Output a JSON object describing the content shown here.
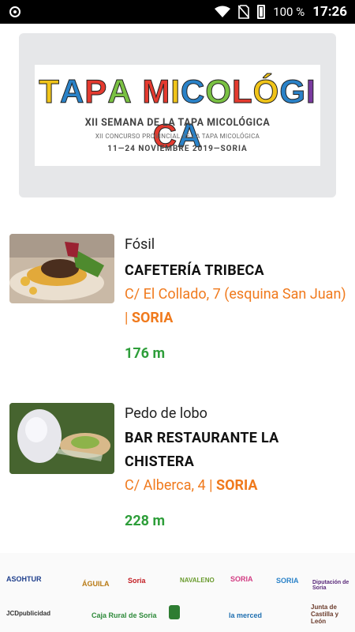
{
  "status_bar": {
    "battery_pct": "100 %",
    "time": "17:26"
  },
  "banner": {
    "title_letters": [
      "T",
      "A",
      "P",
      "A",
      " ",
      "M",
      "I",
      "C",
      "O",
      "L",
      "Ó",
      "G",
      "I",
      "C",
      "A"
    ],
    "title_colors": [
      "#f0c419",
      "#2a82c8",
      "#e43a2f",
      "#7ac143",
      "#ffffff",
      "#e43a2f",
      "#f0c419",
      "#2a82c8",
      "#7ac143",
      "#e43a2f",
      "#f0c419",
      "#2a82c8",
      "#7a3aa0",
      "#e43a2f",
      "#2a82c8"
    ],
    "subtitle": "XII SEMANA DE LA TAPA MICOLÓGICA",
    "contest": "XII CONCURSO PROVINCIAL DE LA TAPA MICOLÓGICA",
    "dates": "11—24 NOVIEMBRE 2019—SORIA"
  },
  "listings": [
    {
      "tapa": "Fósil",
      "bar": "CAFETERÍA TRIBECA",
      "address": "C/ El Collado, 7 (esquina San Juan) | ",
      "city": "SORIA",
      "distance": "176 m"
    },
    {
      "tapa": "Pedo de lobo",
      "bar": "BAR RESTAURANTE LA CHISTERA",
      "address": "C/ Alberca, 4 | ",
      "city": "SORIA",
      "distance": "228 m"
    }
  ],
  "sponsors": {
    "row1": [
      "ASOHTUR",
      "ÁGUILA",
      "Soria",
      "NAVALENO",
      "SORIA",
      "SORIA",
      "Diputación de Soria"
    ],
    "row2": [
      "JCDpublicidad",
      "Caja Rural de Soria",
      "",
      "la merced",
      "Junta de Castilla y León"
    ]
  }
}
